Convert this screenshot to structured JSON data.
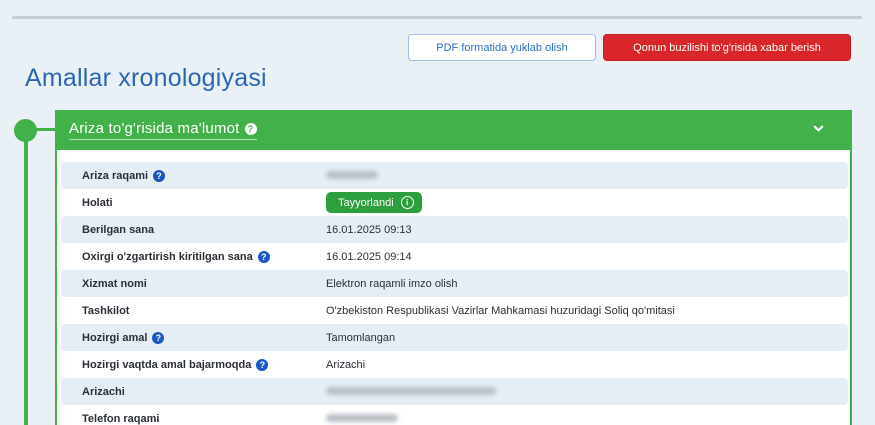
{
  "toolbar": {
    "pdf_label": "PDF formatida yuklab olish",
    "report_label": "Qonun buzilishi to'g'risida xabar berish"
  },
  "page": {
    "title": "Amallar xronologiyasi"
  },
  "card": {
    "header_title": "Ariza to'g'risida ma'lumot",
    "header_help_icon": "question-circle-icon",
    "collapse_icon": "chevron-down-icon"
  },
  "rows": [
    {
      "label": "Ariza raqami",
      "help": true,
      "value": "",
      "redacted": true
    },
    {
      "label": "Holati",
      "help": false,
      "value": "Tayyorlandi",
      "badge": true
    },
    {
      "label": "Berilgan sana",
      "help": false,
      "value": "16.01.2025 09:13"
    },
    {
      "label": "Oxirgi o'zgartirish kiritilgan sana",
      "help": true,
      "value": "16.01.2025 09:14"
    },
    {
      "label": "Xizmat nomi",
      "help": false,
      "value": "Elektron raqamli imzo olish"
    },
    {
      "label": "Tashkilot",
      "help": false,
      "value": "O'zbekiston Respublikasi Vazirlar Mahkamasi huzuridagi Soliq qo'mitasi"
    },
    {
      "label": "Hozirgi amal",
      "help": true,
      "value": "Tamomlangan"
    },
    {
      "label": "Hozirgi vaqtda amal bajarmoqda",
      "help": true,
      "value": "Arizachi"
    },
    {
      "label": "Arizachi",
      "help": false,
      "value": "",
      "redacted": true
    },
    {
      "label": "Telefon raqami",
      "help": false,
      "value": "",
      "redacted": true
    }
  ],
  "colors": {
    "accent_green": "#43b14a",
    "danger_red": "#d9262b",
    "title_blue": "#2c66b3"
  }
}
